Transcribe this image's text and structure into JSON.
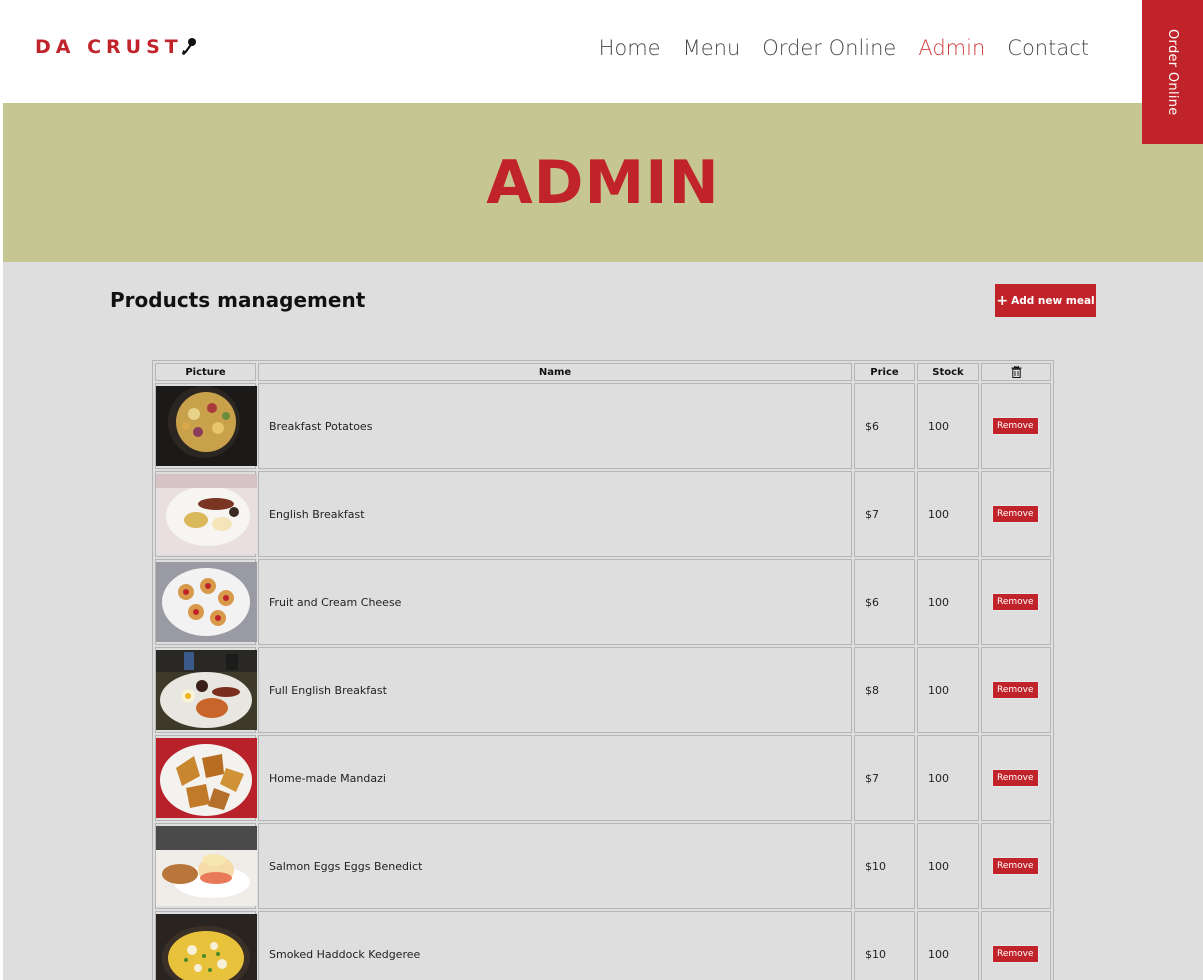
{
  "header": {
    "logo_text": "DA CRUST",
    "logo_icon": "pizza-cutter-icon",
    "nav": [
      "Home",
      "Menu",
      "Order Online",
      "Admin",
      "Contact"
    ],
    "active_nav": "Admin",
    "order_tab_label": "Order Online"
  },
  "hero": {
    "title": "ADMIN"
  },
  "main": {
    "section_title": "Products management",
    "add_button_label": "Add new meal",
    "table": {
      "headers": [
        "Picture",
        "Name",
        "Price",
        "Stock"
      ],
      "delete_header_icon": "trash-icon",
      "remove_label": "Remove",
      "rows": [
        {
          "name": "Breakfast Potatoes",
          "price": "$6",
          "stock": "100"
        },
        {
          "name": "English Breakfast",
          "price": "$7",
          "stock": "100"
        },
        {
          "name": "Fruit and Cream Cheese",
          "price": "$6",
          "stock": "100"
        },
        {
          "name": "Full English Breakfast",
          "price": "$8",
          "stock": "100"
        },
        {
          "name": "Home-made Mandazi",
          "price": "$7",
          "stock": "100"
        },
        {
          "name": "Salmon Eggs Eggs Benedict",
          "price": "$10",
          "stock": "100"
        },
        {
          "name": "Smoked Haddock Kedgeree",
          "price": "$10",
          "stock": "100"
        }
      ]
    }
  },
  "colors": {
    "accent": "#c0242a",
    "hero_bg": "#c6c692",
    "main_bg": "#dedede"
  }
}
